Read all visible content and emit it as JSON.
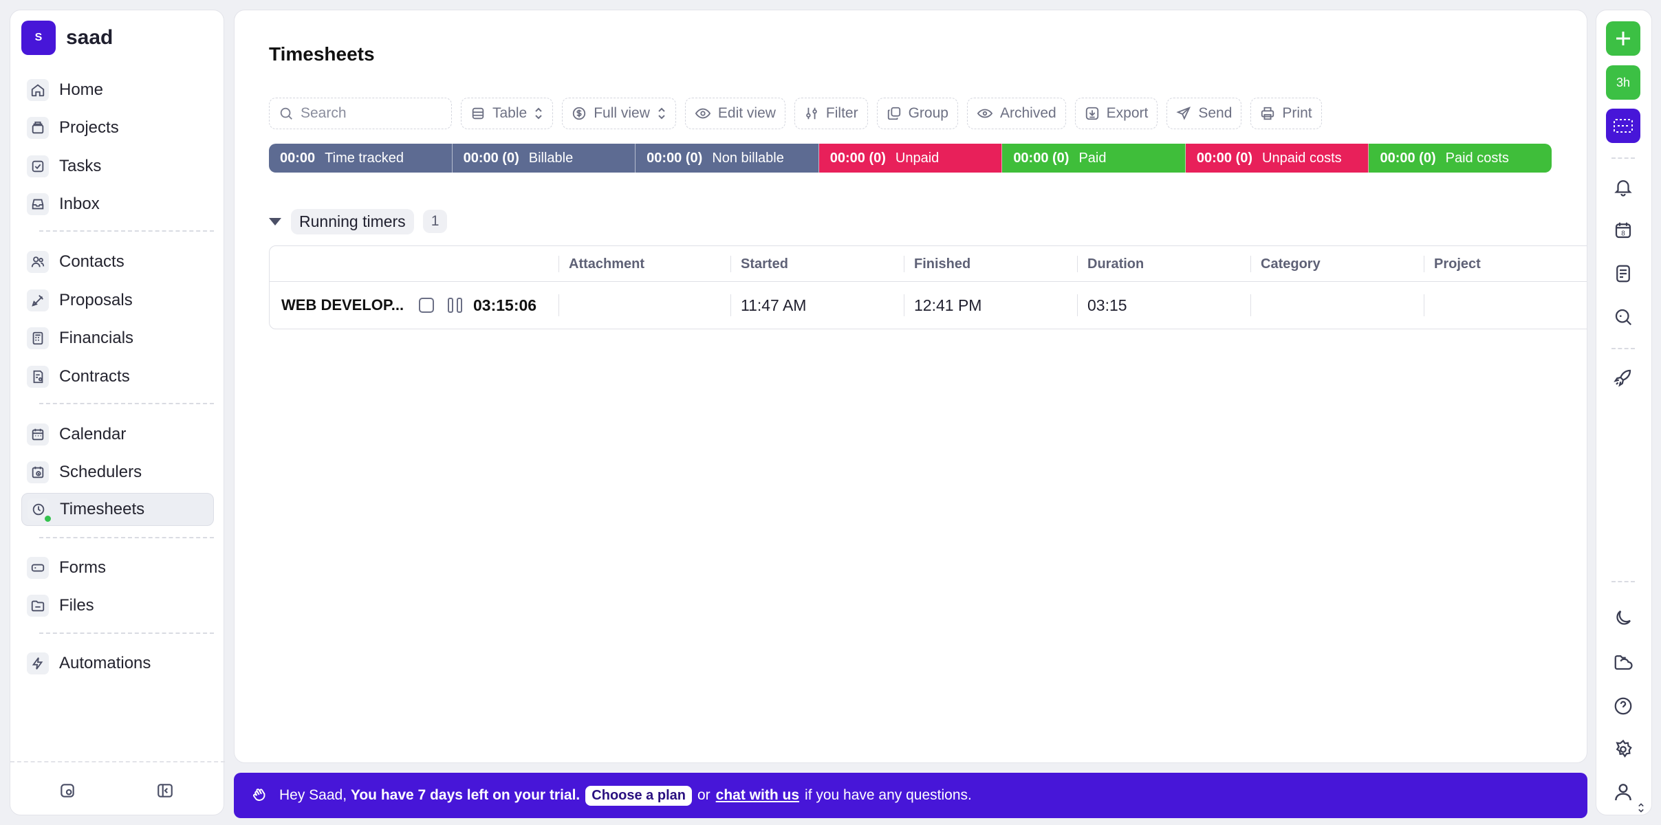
{
  "workspace": {
    "initial": "S",
    "name": "saad"
  },
  "sidebar": {
    "items": [
      {
        "label": "Home",
        "icon": "home-icon"
      },
      {
        "label": "Projects",
        "icon": "projects-icon"
      },
      {
        "label": "Tasks",
        "icon": "tasks-icon"
      },
      {
        "label": "Inbox",
        "icon": "inbox-icon"
      },
      {
        "label": "Contacts",
        "icon": "contacts-icon"
      },
      {
        "label": "Proposals",
        "icon": "proposals-icon"
      },
      {
        "label": "Financials",
        "icon": "financials-icon"
      },
      {
        "label": "Contracts",
        "icon": "contracts-icon"
      },
      {
        "label": "Calendar",
        "icon": "calendar-icon"
      },
      {
        "label": "Schedulers",
        "icon": "schedulers-icon"
      },
      {
        "label": "Timesheets",
        "icon": "timesheets-icon",
        "active": true
      },
      {
        "label": "Forms",
        "icon": "forms-icon"
      },
      {
        "label": "Files",
        "icon": "files-icon"
      },
      {
        "label": "Automations",
        "icon": "automations-icon"
      }
    ]
  },
  "page": {
    "title": "Timesheets"
  },
  "toolbar": {
    "search_placeholder": "Search",
    "table_label": "Table",
    "view_label": "Full view",
    "edit_view_label": "Edit view",
    "filter_label": "Filter",
    "group_label": "Group",
    "archived_label": "Archived",
    "export_label": "Export",
    "send_label": "Send",
    "print_label": "Print"
  },
  "summary": [
    {
      "value": "00:00",
      "label": "Time tracked",
      "color": "#5d6b92"
    },
    {
      "value": "00:00 (0)",
      "label": "Billable",
      "color": "#5d6b92"
    },
    {
      "value": "00:00 (0)",
      "label": "Non billable",
      "color": "#5d6b92"
    },
    {
      "value": "00:00 (0)",
      "label": "Unpaid",
      "color": "#e8205a"
    },
    {
      "value": "00:00 (0)",
      "label": "Paid",
      "color": "#3fbe3a"
    },
    {
      "value": "00:00 (0)",
      "label": "Unpaid costs",
      "color": "#e8205a"
    },
    {
      "value": "00:00 (0)",
      "label": "Paid costs",
      "color": "#3fbe3a"
    }
  ],
  "group": {
    "label": "Running timers",
    "count": "1"
  },
  "table": {
    "columns": [
      "Attachment",
      "Started",
      "Finished",
      "Duration",
      "Category",
      "Project"
    ],
    "rows": [
      {
        "name": "WEB DEVELOP...",
        "timer": "03:15:06",
        "attachment": "",
        "started": "11:47 AM",
        "finished": "12:41 PM",
        "duration": "03:15",
        "category": "",
        "project": ""
      }
    ]
  },
  "banner": {
    "greeting": "Hey Saad, ",
    "trial_text": "You have 7 days left on your trial.",
    "cta": "Choose a plan",
    "or": "or",
    "chat_link": "chat with us",
    "tail": "if you have any questions."
  },
  "rail": {
    "timer_badge": "3h",
    "calendar_day": "8"
  },
  "colors": {
    "brand": "#4716d8",
    "success": "#3cc044",
    "danger": "#e8205a",
    "neutral": "#5d6b92"
  }
}
